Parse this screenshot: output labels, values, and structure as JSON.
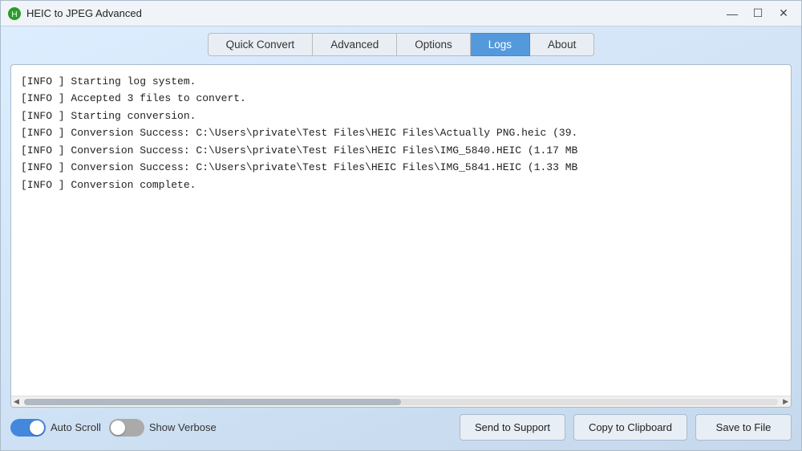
{
  "window": {
    "title": "HEIC to JPEG Advanced",
    "icon": "app-icon"
  },
  "titlebar": {
    "minimize_label": "—",
    "maximize_label": "☐",
    "close_label": "✕"
  },
  "tabs": [
    {
      "id": "quick-convert",
      "label": "Quick Convert",
      "active": false
    },
    {
      "id": "advanced",
      "label": "Advanced",
      "active": false
    },
    {
      "id": "options",
      "label": "Options",
      "active": false
    },
    {
      "id": "logs",
      "label": "Logs",
      "active": true
    },
    {
      "id": "about",
      "label": "About",
      "active": false
    }
  ],
  "log": {
    "lines": [
      "[INFO   ] Starting log system.",
      "[INFO   ] Accepted 3 files to convert.",
      "[INFO   ] Starting conversion.",
      "[INFO   ] Conversion Success: C:\\Users\\private\\Test Files\\HEIC Files\\Actually PNG.heic (39.",
      "[INFO   ] Conversion Success: C:\\Users\\private\\Test Files\\HEIC Files\\IMG_5840.HEIC (1.17 MB",
      "[INFO   ] Conversion Success: C:\\Users\\private\\Test Files\\HEIC Files\\IMG_5841.HEIC (1.33 MB",
      "[INFO   ] Conversion complete."
    ]
  },
  "controls": {
    "auto_scroll_label": "Auto Scroll",
    "auto_scroll_on": true,
    "show_verbose_label": "Show Verbose",
    "show_verbose_on": false,
    "send_to_support_label": "Send to Support",
    "copy_to_clipboard_label": "Copy to Clipboard",
    "save_to_file_label": "Save to File"
  }
}
